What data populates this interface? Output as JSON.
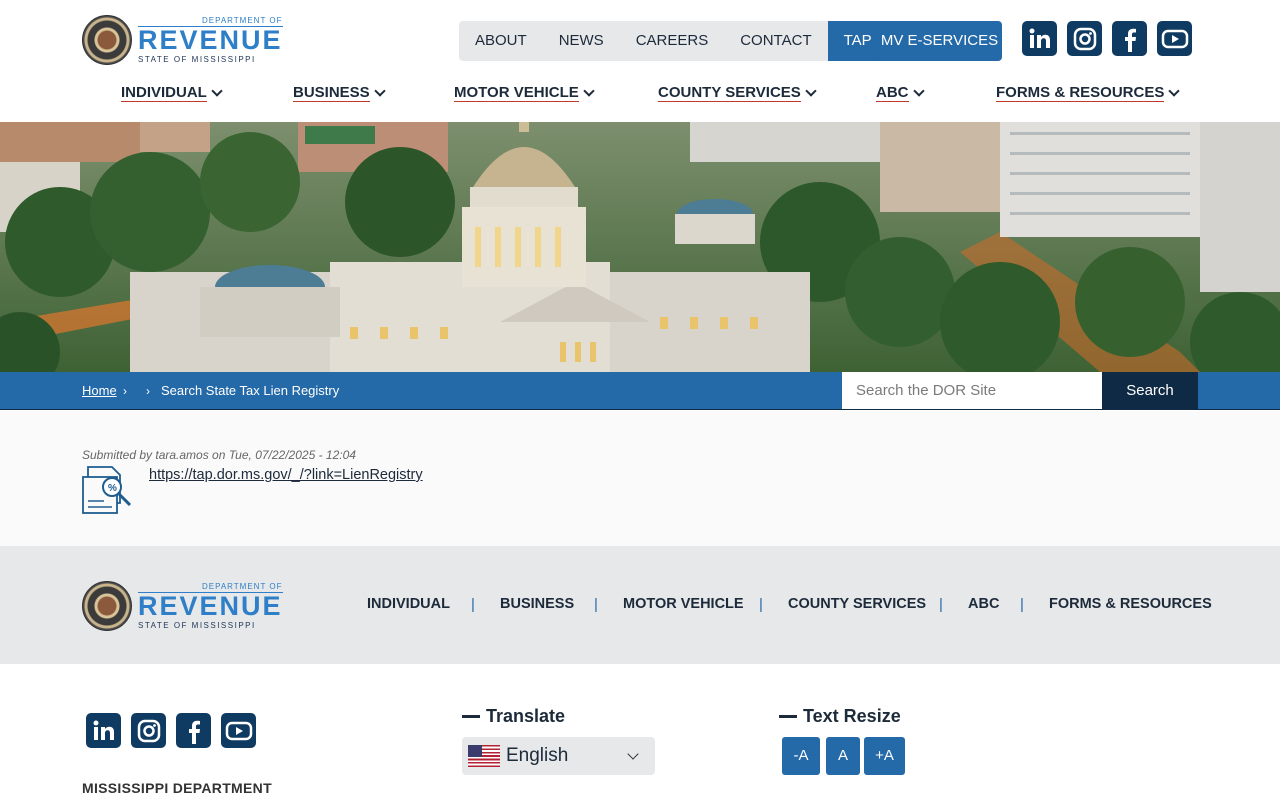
{
  "logo": {
    "top": "DEPARTMENT OF",
    "main": "REVENUE",
    "bottom": "STATE OF MISSISSIPPI"
  },
  "top_nav": {
    "items": [
      "ABOUT",
      "NEWS",
      "CAREERS",
      "CONTACT",
      "TAP"
    ],
    "mv_button": "MV E-SERVICES"
  },
  "social_icons": [
    "linkedin-icon",
    "instagram-icon",
    "facebook-icon",
    "youtube-icon"
  ],
  "main_nav": {
    "items": [
      "INDIVIDUAL",
      "BUSINESS",
      "MOTOR VEHICLE",
      "COUNTY SERVICES",
      "ABC",
      "FORMS & RESOURCES"
    ]
  },
  "breadcrumb": {
    "home": "Home",
    "current": "Search State Tax Lien Registry"
  },
  "search": {
    "placeholder": "Search the DOR Site",
    "button": "Search"
  },
  "content": {
    "submitted": "Submitted by tara.amos on Tue, 07/22/2025 - 12:04",
    "link": "https://tap.dor.ms.gov/_/?link=LienRegistry"
  },
  "footer_nav": {
    "items": [
      "INDIVIDUAL",
      "BUSINESS",
      "MOTOR VEHICLE",
      "COUNTY SERVICES",
      "ABC",
      "FORMS & RESOURCES"
    ],
    "separator": "|"
  },
  "footer": {
    "org": "MISSISSIPPI DEPARTMENT",
    "translate_title": "Translate",
    "language": "English",
    "text_resize_title": "Text Resize",
    "resize_buttons": [
      "-A",
      "A",
      "+A"
    ]
  },
  "colors": {
    "brand_blue": "#2469a8",
    "navy": "#0f2a44",
    "nav_underline": "#c0392b"
  }
}
